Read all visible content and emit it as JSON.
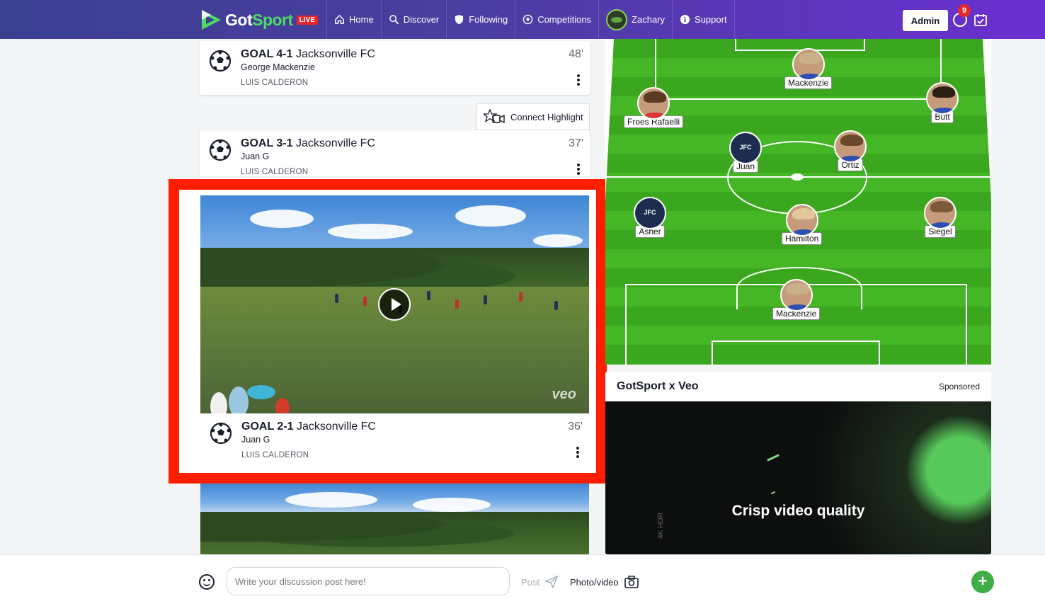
{
  "nav": {
    "logo_got": "Got",
    "logo_sport": "Sport",
    "logo_badge": "LIVE",
    "items": [
      {
        "label": "Home",
        "icon": "home-icon"
      },
      {
        "label": "Discover",
        "icon": "search-icon"
      },
      {
        "label": "Following",
        "icon": "shield-icon"
      },
      {
        "label": "Competitions",
        "icon": "soccer-ball-icon"
      },
      {
        "label": "Zachary",
        "icon": "avatar"
      },
      {
        "label": "Support",
        "icon": "info-icon"
      }
    ],
    "admin_label": "Admin",
    "notification_count": "9"
  },
  "feed": {
    "connect_highlight_label": "Connect Highlight",
    "goals": [
      {
        "score": "GOAL 4-1",
        "team": "Jacksonville FC",
        "scorer": "George Mackenzie",
        "credit": "LUIS CALDERON",
        "minute": "48'"
      },
      {
        "score": "GOAL 3-1",
        "team": "Jacksonville FC",
        "scorer": "Juan G",
        "credit": "LUIS CALDERON",
        "minute": "37'"
      },
      {
        "score": "GOAL 2-1",
        "team": "Jacksonville FC",
        "scorer": "Juan G",
        "credit": "LUIS CALDERON",
        "minute": "36'"
      }
    ],
    "video_watermark": "veo"
  },
  "lineup": {
    "players": [
      {
        "name": "Mackenzie",
        "type": "photo"
      },
      {
        "name": "Froes Rafaelli",
        "type": "photo"
      },
      {
        "name": "Butt",
        "type": "photo"
      },
      {
        "name": "Juan",
        "type": "crest"
      },
      {
        "name": "Ortiz",
        "type": "photo"
      },
      {
        "name": "Asher",
        "type": "crest"
      },
      {
        "name": "Hamilton",
        "type": "photo"
      },
      {
        "name": "Siegel",
        "type": "photo"
      },
      {
        "name": "Mackenzie",
        "type": "photo"
      }
    ]
  },
  "sponsor": {
    "title": "GotSport x Veo",
    "tag": "Sponsored",
    "caption": "Crisp video quality",
    "hdr": "4K HDR"
  },
  "composer": {
    "placeholder": "Write your discussion post here!",
    "post_label": "Post",
    "photo_label": "Photo/video",
    "add_label": "+"
  },
  "colors": {
    "nav_start": "#3a3f92",
    "nav_end": "#6a2fd0",
    "highlight_border": "#ff1f00",
    "pitch_green": "#3ba71e",
    "accent_green": "#3fae47",
    "live_red": "#e8262b"
  }
}
